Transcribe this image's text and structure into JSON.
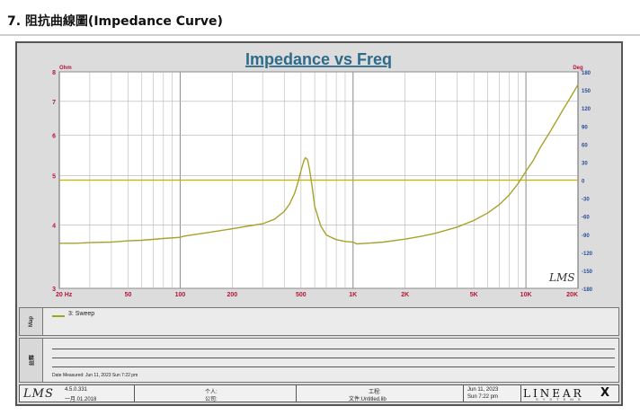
{
  "heading": "7.  阻抗曲線圖(Impedance Curve)",
  "colors": {
    "curve": "#a8a22a",
    "reference": "#c9b000",
    "axis_text": "#b5173a",
    "title": "#2e6b8a",
    "right_axis_text": "#2a4f9a"
  },
  "chart_data": {
    "type": "line",
    "title": "Impedance vs Freq",
    "y_left_unit": "Ohm",
    "y_right_unit": "Deg",
    "x_scale": "log",
    "y_left_scale": "log",
    "xlim": [
      20,
      20000
    ],
    "ylim_left": [
      3,
      8
    ],
    "ylim_right": [
      -180,
      180
    ],
    "grid": true,
    "x_ticks": [
      {
        "value": 20,
        "label": "20  Hz"
      },
      {
        "value": 50,
        "label": "50"
      },
      {
        "value": 100,
        "label": "100"
      },
      {
        "value": 200,
        "label": "200"
      },
      {
        "value": 500,
        "label": "500"
      },
      {
        "value": 1000,
        "label": "1K"
      },
      {
        "value": 2000,
        "label": "2K"
      },
      {
        "value": 5000,
        "label": "5K"
      },
      {
        "value": 10000,
        "label": "10K"
      },
      {
        "value": 20000,
        "label": "20K"
      }
    ],
    "y_left_ticks": [
      {
        "value": 3,
        "label": "3"
      },
      {
        "value": 4,
        "label": "4"
      },
      {
        "value": 5,
        "label": "5"
      },
      {
        "value": 6,
        "label": "6"
      },
      {
        "value": 7,
        "label": "7"
      },
      {
        "value": 8,
        "label": "8"
      }
    ],
    "y_right_ticks": [
      {
        "value": 180,
        "label": "180"
      },
      {
        "value": 150,
        "label": "150"
      },
      {
        "value": 120,
        "label": "120"
      },
      {
        "value": 90,
        "label": "90"
      },
      {
        "value": 60,
        "label": "60"
      },
      {
        "value": 30,
        "label": "30"
      },
      {
        "value": 0,
        "label": "0"
      },
      {
        "value": -30,
        "label": "-30"
      },
      {
        "value": -60,
        "label": "-60"
      },
      {
        "value": -90,
        "label": "-90"
      },
      {
        "value": -120,
        "label": "-120"
      },
      {
        "value": -150,
        "label": "-150"
      },
      {
        "value": -180,
        "label": "-180"
      }
    ],
    "reference_line": {
      "axis": "right",
      "value": 0
    },
    "series": [
      {
        "name": "3: Sweep",
        "x": [
          20,
          25,
          30,
          40,
          50,
          60,
          80,
          100,
          105,
          150,
          200,
          250,
          300,
          350,
          400,
          430,
          460,
          480,
          500,
          520,
          530,
          545,
          560,
          580,
          600,
          650,
          700,
          800,
          900,
          1000,
          1050,
          1200,
          1500,
          2000,
          2500,
          3000,
          4000,
          5000,
          6000,
          7000,
          8000,
          9000,
          10000,
          11000,
          12000,
          14000,
          16000,
          18000,
          20000
        ],
        "y": [
          3.68,
          3.68,
          3.69,
          3.7,
          3.72,
          3.73,
          3.76,
          3.78,
          3.8,
          3.87,
          3.93,
          3.98,
          4.02,
          4.1,
          4.25,
          4.4,
          4.62,
          4.85,
          5.12,
          5.35,
          5.42,
          5.38,
          5.15,
          4.75,
          4.35,
          3.98,
          3.82,
          3.74,
          3.71,
          3.7,
          3.67,
          3.68,
          3.7,
          3.75,
          3.8,
          3.85,
          3.96,
          4.08,
          4.22,
          4.38,
          4.58,
          4.82,
          5.1,
          5.35,
          5.65,
          6.15,
          6.65,
          7.1,
          7.55
        ]
      }
    ]
  },
  "watermark": "LMS",
  "legend": {
    "entry": "3: Sweep",
    "tab_label": "Map"
  },
  "notes": {
    "tab_label": "註釋",
    "date_measured": "Date Measured: Jun 11, 2023  Sun  7:22 pm"
  },
  "footer": {
    "logo": "LMS",
    "version": "4.5.0.331",
    "build_date": "一月.01.2018",
    "person_label": "个人:",
    "company_label": "公司:",
    "project_label": "工程:",
    "file_label": "文件:Untitled.lib",
    "date": "Jun 11, 2023",
    "time": "Sun  7:22 pm",
    "brand": "LINEAR",
    "brand_x": "X",
    "brand_sub": "S Y S T E M S"
  }
}
